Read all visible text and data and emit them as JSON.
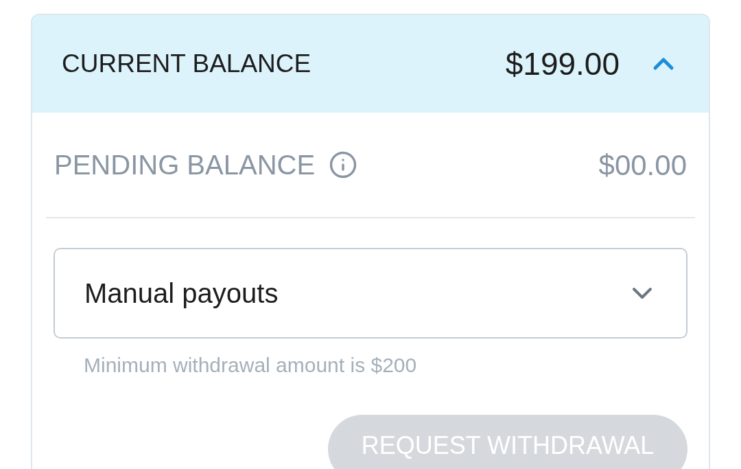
{
  "balance_header": {
    "title": "CURRENT BALANCE",
    "amount": "$199.00",
    "expanded": true
  },
  "pending": {
    "label": "PENDING BALANCE",
    "amount": "$00.00"
  },
  "payout_select": {
    "value": "Manual payouts"
  },
  "helper_text": "Minimum withdrawal amount is $200",
  "withdraw_button": {
    "label": "REQUEST WITHDRAWAL",
    "disabled": true
  }
}
